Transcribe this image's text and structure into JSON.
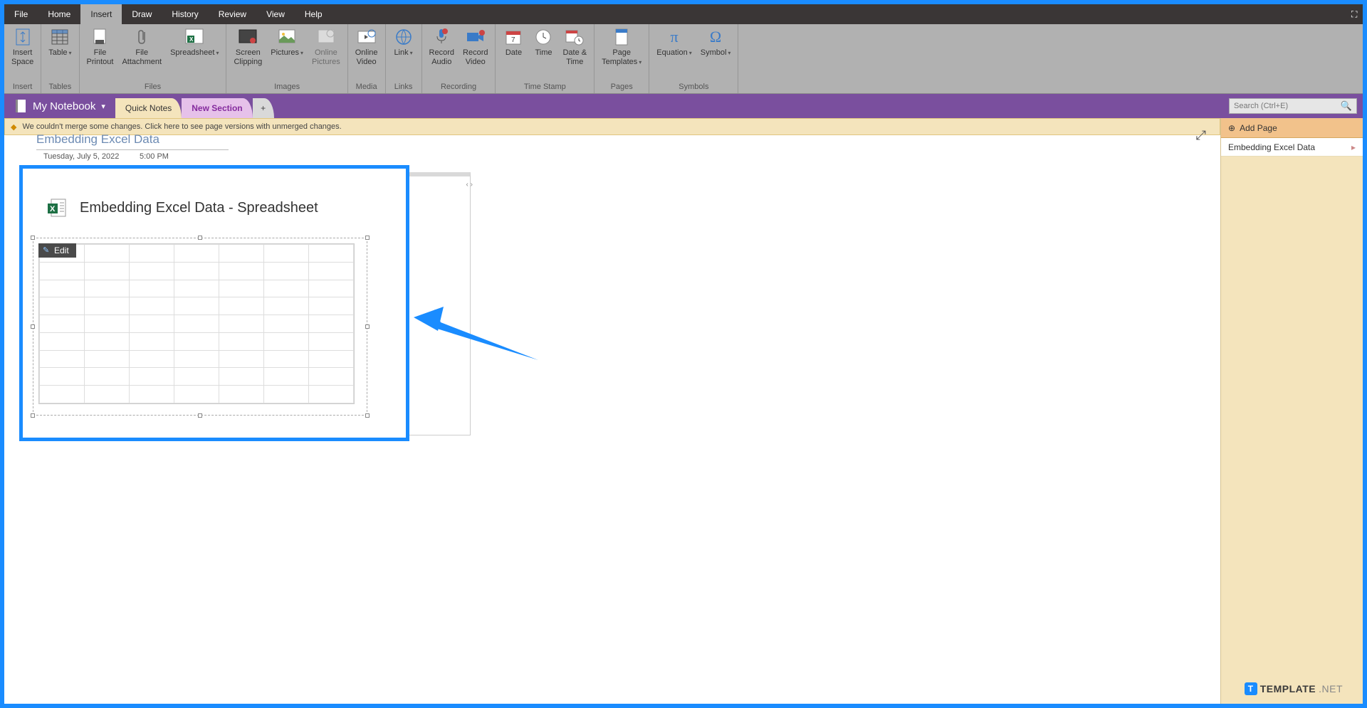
{
  "menu": {
    "file": "File",
    "home": "Home",
    "insert": "Insert",
    "draw": "Draw",
    "history": "History",
    "review": "Review",
    "view": "View",
    "help": "Help"
  },
  "ribbon": {
    "groups": {
      "insert": {
        "label": "Insert",
        "insert_space": "Insert\nSpace"
      },
      "tables": {
        "label": "Tables",
        "table": "Table"
      },
      "files": {
        "label": "Files",
        "printout": "File\nPrintout",
        "attachment": "File\nAttachment",
        "spreadsheet": "Spreadsheet"
      },
      "images": {
        "label": "Images",
        "clipping": "Screen\nClipping",
        "pictures": "Pictures",
        "online_pictures": "Online\nPictures"
      },
      "media": {
        "label": "Media",
        "online_video": "Online\nVideo"
      },
      "links": {
        "label": "Links",
        "link": "Link"
      },
      "recording": {
        "label": "Recording",
        "audio": "Record\nAudio",
        "video": "Record\nVideo"
      },
      "timestamp": {
        "label": "Time Stamp",
        "date": "Date",
        "time": "Time",
        "datetime": "Date &\nTime"
      },
      "pages": {
        "label": "Pages",
        "templates": "Page\nTemplates"
      },
      "symbols": {
        "label": "Symbols",
        "equation": "Equation",
        "symbol": "Symbol"
      }
    }
  },
  "notebook": {
    "name": "My Notebook"
  },
  "tabs": {
    "quick": "Quick Notes",
    "new": "New Section",
    "add": "+"
  },
  "search": {
    "placeholder": "Search (Ctrl+E)"
  },
  "warning": "We couldn't merge some changes. Click here to see page versions with unmerged changes.",
  "page": {
    "title": "Embedding Excel Data",
    "date": "Tuesday, July 5, 2022",
    "time": "5:00 PM",
    "embed_title": "Embedding Excel Data - Spreadsheet",
    "edit": "Edit"
  },
  "pagelist": {
    "add": "Add Page",
    "item1": "Embedding Excel Data"
  },
  "watermark": {
    "brand": "TEMPLATE",
    "suffix": ".NET"
  }
}
